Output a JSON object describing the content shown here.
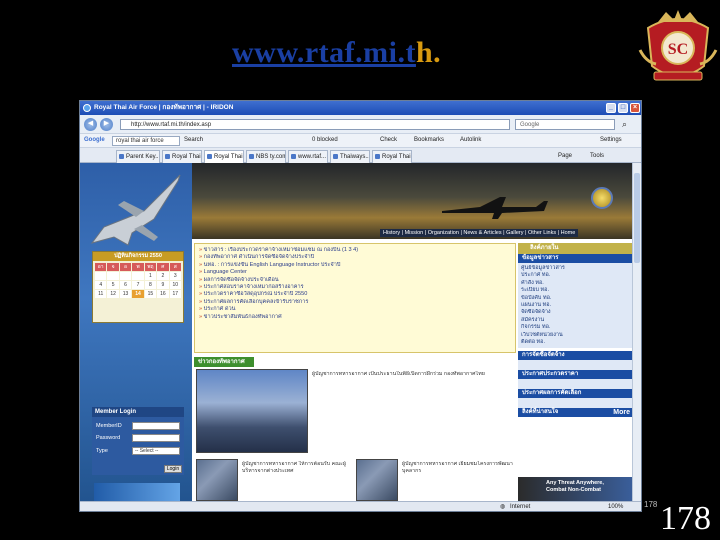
{
  "slide": {
    "title_main": "www.rtaf.mi.t",
    "title_end": "h.",
    "page_number": "178",
    "page_number_small": "178"
  },
  "colors": {
    "title_blue": "#1a3fa3",
    "title_gold": "#d89a10",
    "background": "#000000"
  },
  "browser": {
    "window_title": "Royal Thai Air Force | กองทัพอากาศ | - IRIDON",
    "address": "http://www.rtaf.mi.th/index.asp",
    "search_placeholder": "Google",
    "google_search": "royal thai air force",
    "google_items": [
      "Search",
      "Check",
      "Bookmarks",
      "Autolink",
      "Settings"
    ],
    "blocked_label": "0 blocked",
    "tabs": [
      "Parent Key...",
      "Royal Thai...",
      "Royal Thai...",
      "NBS ty.com...",
      "www.rtaf...",
      "Thaiways...",
      "Royal Thai..."
    ],
    "tools": [
      "Page",
      "Tools"
    ],
    "status_text": "Internet",
    "zoom": "100%",
    "window_buttons": [
      "_",
      "□",
      "×"
    ]
  },
  "site": {
    "nav": "History | Mission | Organization | News & Articles | Gallery | Other Links | Home",
    "calendar_month": "ปฏิทินกิจกรรม 2550",
    "calendar_days": [
      "อา",
      "จ",
      "อ",
      "พ",
      "พฤ",
      "ศ",
      "ส",
      "",
      "",
      "",
      "",
      "1",
      "2",
      "3",
      "4",
      "5",
      "6",
      "7",
      "8",
      "9",
      "10",
      "11",
      "12",
      "13",
      "14",
      "15",
      "16",
      "17"
    ],
    "calendar_today": "14",
    "login_title": "Member Login",
    "login_id_label": "MemberID",
    "login_pw_label": "Password",
    "login_type_label": "Type",
    "login_type_value": "-- Select --",
    "login_button": "Login",
    "news_items": [
      "ข่าวสาร : เรื่องประกวดราคาจ้างเหมาซ่อมแซม ณ กองบิน (1 3 4)",
      "กองทัพอากาศ ดำเนินการจัดซื้อจัดจ้างประจำปี",
      "นทอ. : การแข่งขัน English Language Instructor ประจำปี",
      "Language Center",
      "ผลการจัดซื้อจัดจ้างประจำเดือน",
      "ประกาศสอบราคาจ้างเหมาก่อสร้างอาคาร",
      "ประกวดราคาซื้อวัสดุอุปกรณ์ ประจำปี 2550",
      "ประกาศผลการคัดเลือกบุคคลเข้ารับราชการ",
      "ประกาศ ด่วน",
      "ข่าวประชาสัมพันธ์กองทัพอากาศ"
    ],
    "section_heading": "ข่าวกองทัพอากาศ",
    "photo_caption_1": "ผู้บัญชาการทหารอากาศ เป็นประธานในพิธีเปิดการฝึกร่วม กองทัพอากาศไทย",
    "photo_caption_2": "ผู้บัญชาการทหารอากาศ ให้การต้อนรับ คณะผู้บริหารจากต่างประเทศ",
    "photo_caption_3": "ผู้บัญชาการทหารอากาศ เยี่ยมชมโครงการพัฒนาบุคลากร",
    "right_head": "ลิงค์ภายใน",
    "right_blue_1": "ข้อมูลข่าวสาร",
    "right_list_1": [
      "ศูนย์ข้อมูลข่าวสาร",
      "ประกาศ ทอ.",
      "คำสั่ง ทอ.",
      "ระเบียบ ทอ.",
      "ข้อบังคับ ทอ.",
      "แผนงาน ทอ.",
      "จัดซื้อจัดจ้าง",
      "สมัครงาน",
      "กิจกรรม ทอ.",
      "เว็บไซต์หน่วยงาน",
      "ติดต่อ ทอ."
    ],
    "right_blue_2": "การจัดซื้อจัดจ้าง",
    "right_blue_3": "ประกาศประกวดราคา",
    "right_blue_4": "ประกาศผลการคัดเลือก",
    "right_blue_5": "ลิงค์ที่น่าสนใจ",
    "more_label": "More",
    "threat_line1": "Any Threat Anywhere,",
    "threat_line2": "Combat Non-Combat"
  }
}
